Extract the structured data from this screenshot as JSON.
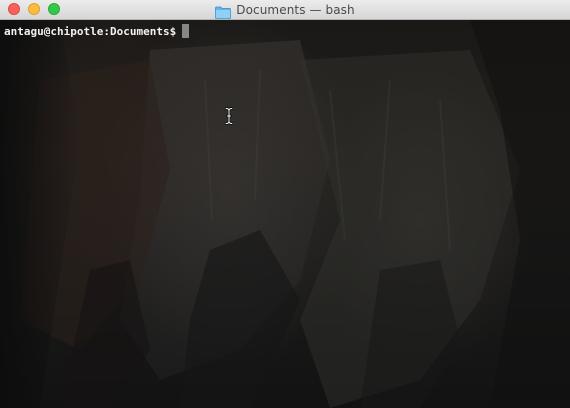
{
  "window": {
    "title": "Documents — bash",
    "title_icon": "folder-icon",
    "controls": {
      "close": "close-button",
      "minimize": "minimize-button",
      "zoom": "zoom-button"
    }
  },
  "terminal": {
    "prompt": "antagu@chipotle:Documents$",
    "input_value": "",
    "cursor": "block-cursor",
    "pointer": "i-beam-cursor-icon"
  },
  "colors": {
    "close": "#fc605c",
    "minimize": "#fdbc40",
    "zoom": "#34c84a",
    "prompt_text": "#f2f2f2",
    "titlebar": "#e4e4e4"
  }
}
